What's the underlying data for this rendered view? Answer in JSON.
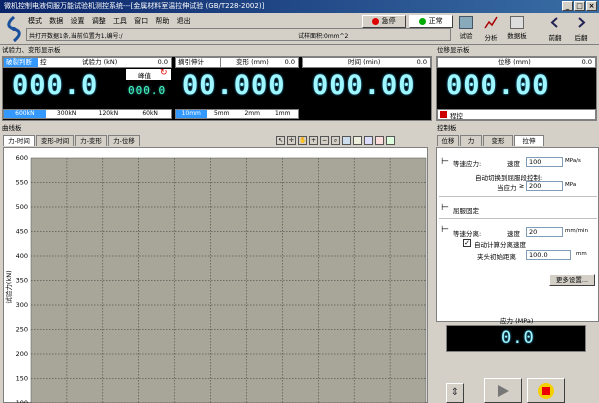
{
  "window": {
    "title": "微机控制电液伺服万能试验机测控系统---[金属材料室温拉伸试验 (GB/T228-2002)]",
    "min": "_",
    "max": "□",
    "close": "×"
  },
  "menu": [
    "模式",
    "数据",
    "设置",
    "调整",
    "工具",
    "窗口",
    "帮助",
    "退出"
  ],
  "info": {
    "text": "共打开数据1条,当前位置为1,编号:/",
    "area": "试样面积:0mm^2"
  },
  "header_buttons": {
    "emergency": "急停",
    "normal": "正常"
  },
  "toolbar": [
    {
      "label": "试验",
      "icon": "test-icon"
    },
    {
      "label": "分析",
      "icon": "analysis-icon"
    },
    {
      "label": "数据板",
      "icon": "data-board-icon"
    },
    {
      "label": "前翻",
      "icon": "prev-icon"
    },
    {
      "label": "后翻",
      "icon": "next-icon"
    }
  ],
  "force_panel": {
    "title": "试验力、变形显示板",
    "broken_label": "破裂判断",
    "control_label": "控",
    "force_label": "试验力 (kN)",
    "force_reset": "0.0",
    "force_value": "000.0",
    "peak_label": "峰值",
    "peak_value": "000.0",
    "force_ranges": [
      "600kN",
      "300kN",
      "120kN",
      "60kN"
    ],
    "extensometer_label": "摘引伸计",
    "deform_label": "变形 (mm)",
    "deform_reset": "0.0",
    "deform_value": "00.000",
    "deform_ranges": [
      "10mm",
      "5mm",
      "2mm",
      "1mm"
    ],
    "time_label": "时间 (min)",
    "time_reset": "0.0",
    "time_value": "000.00"
  },
  "position_panel": {
    "title": "位移显示板",
    "label": "位移 (mm)",
    "reset": "0.0",
    "value": "000.00",
    "program_label": "程控"
  },
  "chart_panel": {
    "title": "曲线板",
    "tabs": [
      "力-时间",
      "变形-时间",
      "力-变形",
      "力-位移"
    ]
  },
  "chart_data": {
    "type": "line",
    "ylabel": "试验力(kN)",
    "ylim": [
      0,
      600
    ],
    "yticks": [
      600,
      550,
      500,
      450,
      400,
      350,
      300,
      250,
      200,
      150,
      100
    ],
    "grid": true,
    "series": []
  },
  "control_panel": {
    "title": "控制板",
    "tabs": [
      "位移",
      "力",
      "变形",
      "拉伸"
    ],
    "stress_rate_label": "等速应力:",
    "stress_speed_label": "速度",
    "stress_speed_value": "100",
    "stress_speed_unit": "MPa/s",
    "auto_switch_label": "自动切换到屈服段控制:",
    "when_stress_label": "当应力",
    "when_stress_op": "≥",
    "when_stress_value": "200",
    "when_stress_unit": "MPa",
    "yield_label": "屈服固定",
    "separation_label": "等速分离:",
    "separation_speed_label": "速度",
    "separation_speed_value": "20",
    "separation_speed_unit": "mm/min",
    "auto_calc_label": "自动计算分离速度",
    "clamp_label": "夹头初始距离",
    "clamp_value": "100.0",
    "clamp_unit": "mm",
    "more_settings": "更多设置..."
  },
  "stress_display": {
    "label": "应力 (MPa)",
    "value": "0.0"
  }
}
